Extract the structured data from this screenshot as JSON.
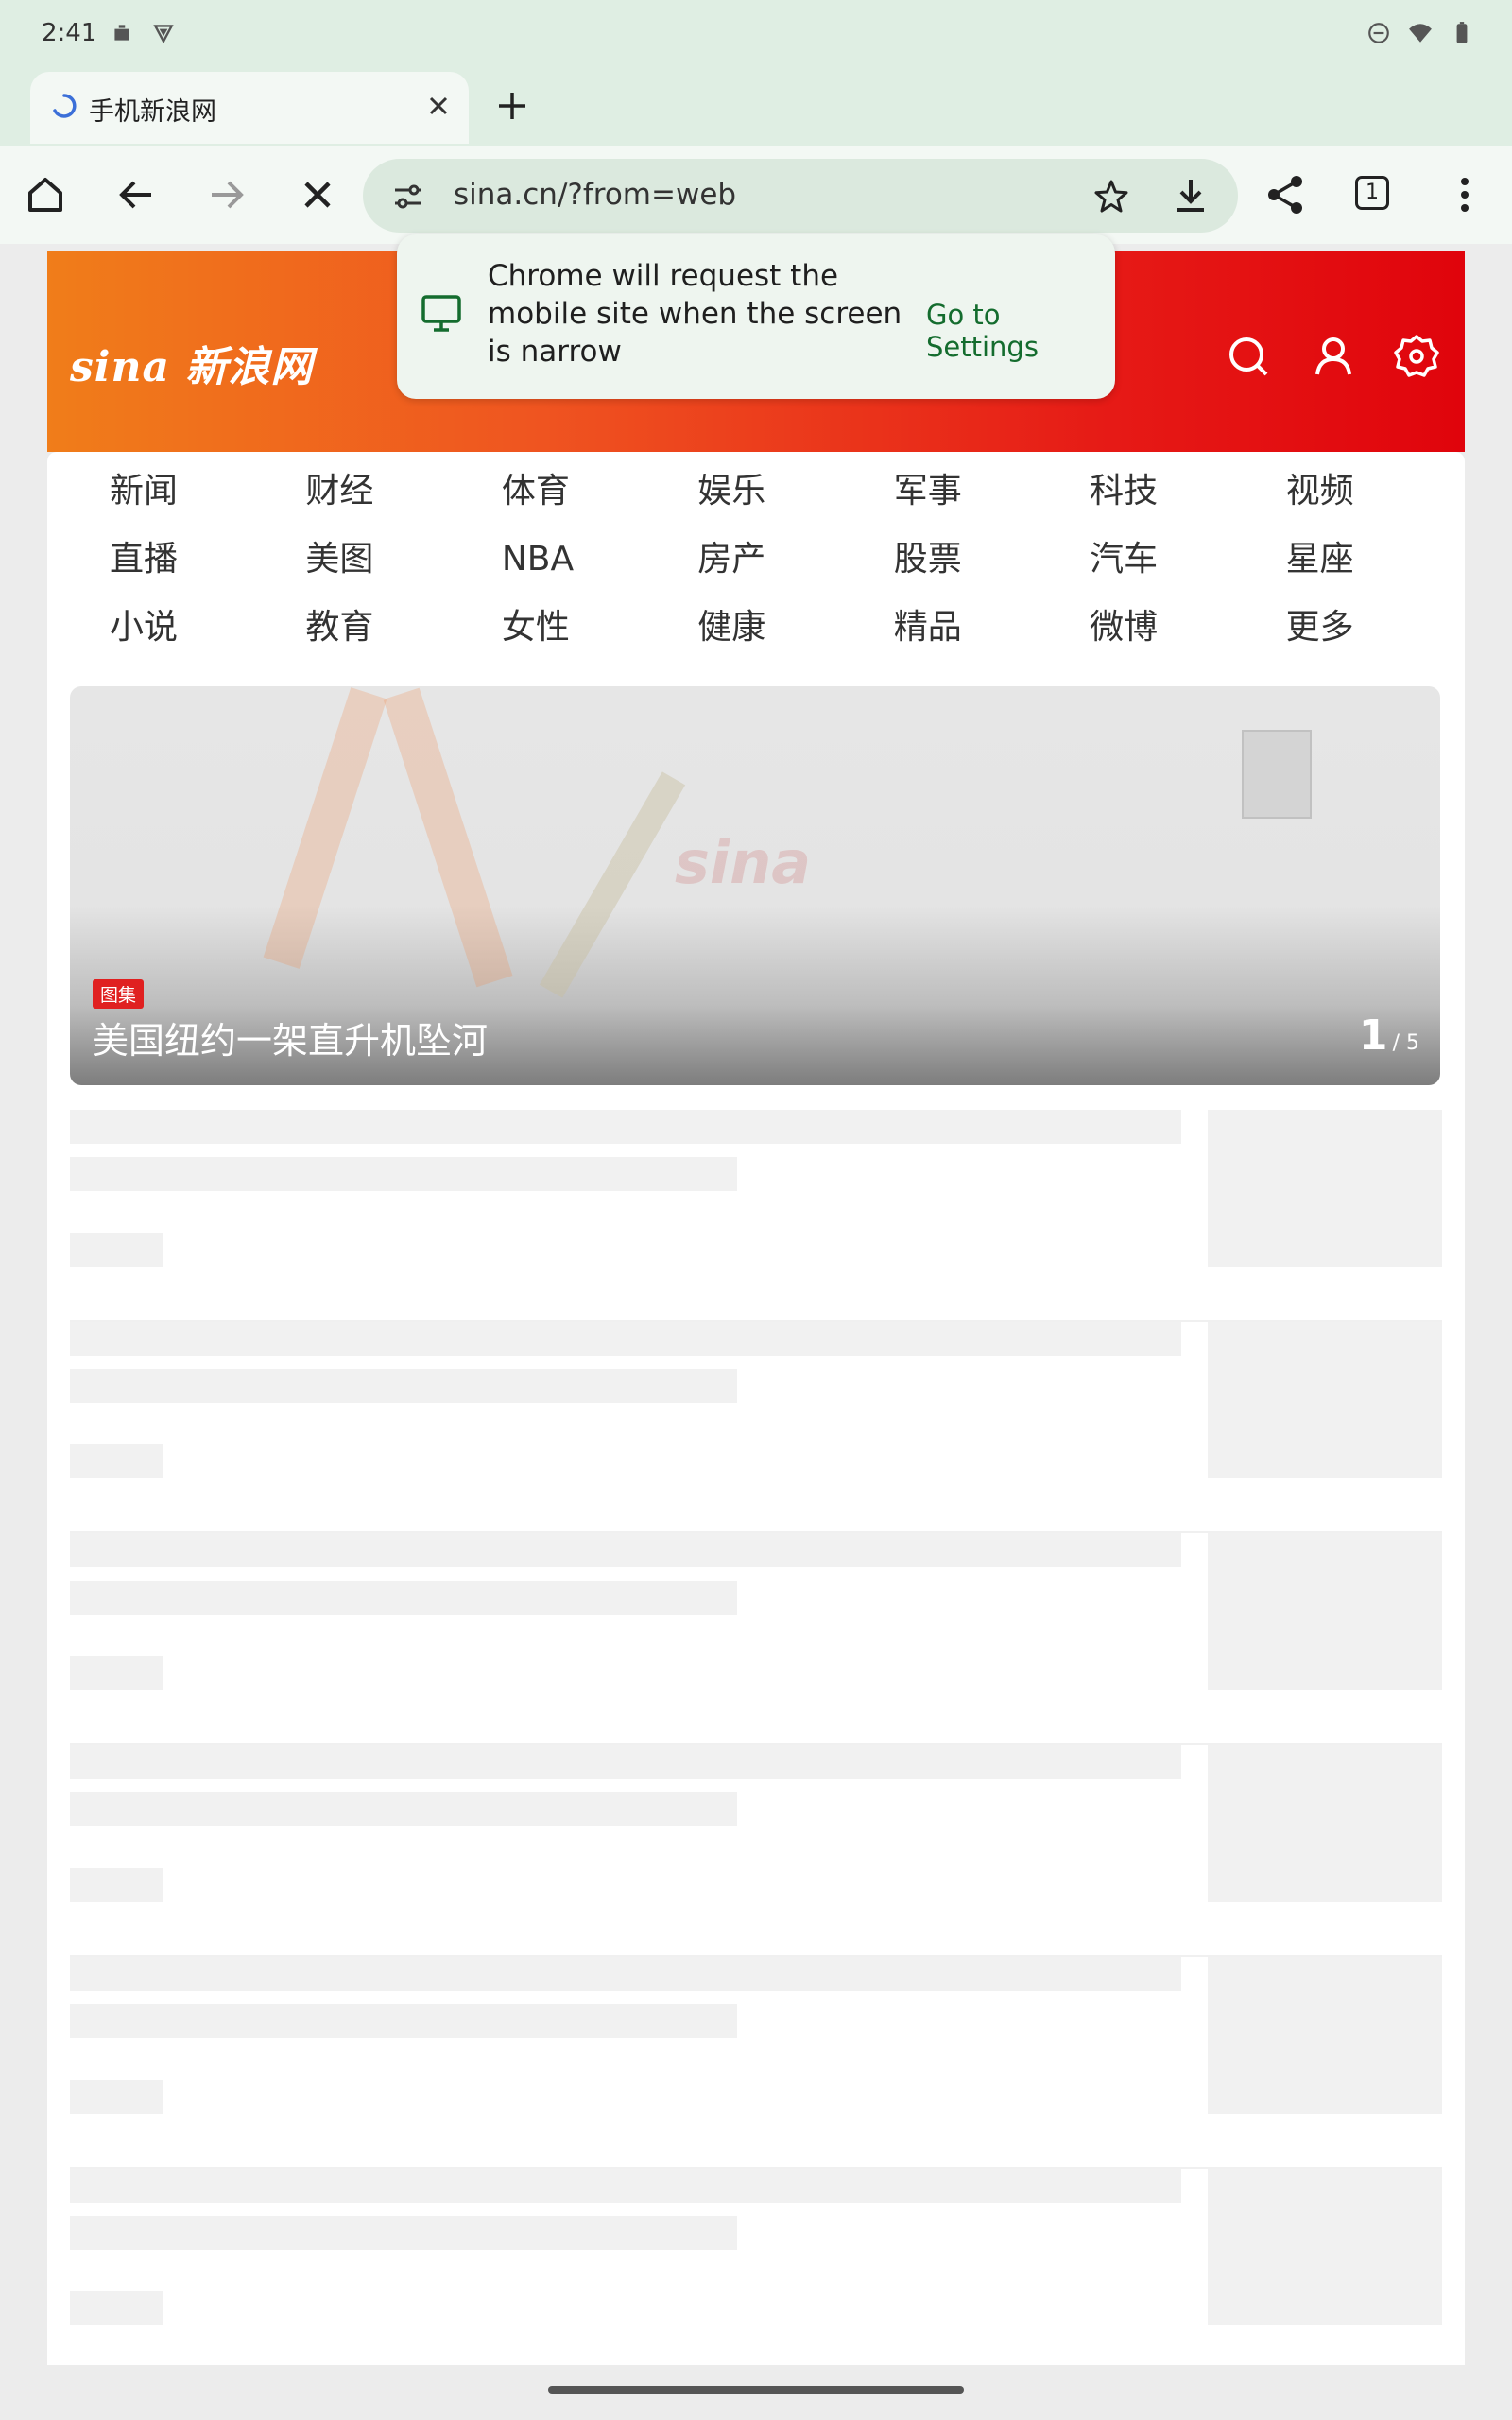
{
  "status_bar": {
    "time": "2:41"
  },
  "tab": {
    "title": "手机新浪网"
  },
  "toolbar": {
    "url": "sina.cn/?from=web",
    "tab_count": "1"
  },
  "popup": {
    "message": "Chrome will request the mobile site when the screen is narrow",
    "action": "Go to Settings"
  },
  "sina": {
    "logo": "sina",
    "brand": "新浪网",
    "nav": [
      "新闻",
      "财经",
      "体育",
      "娱乐",
      "军事",
      "科技",
      "视频",
      "直播",
      "美图",
      "NBA",
      "房产",
      "股票",
      "汽车",
      "星座",
      "小说",
      "教育",
      "女性",
      "健康",
      "精品",
      "微博",
      "更多"
    ]
  },
  "carousel": {
    "badge": "图集",
    "title": "美国纽约一架直升机坠河",
    "watermark": "sina",
    "current": "1",
    "total": "/ 5"
  },
  "colors": {
    "accent": "#146c2e",
    "sina_red": "#e61a16",
    "sina_orange": "#f07d1a"
  }
}
